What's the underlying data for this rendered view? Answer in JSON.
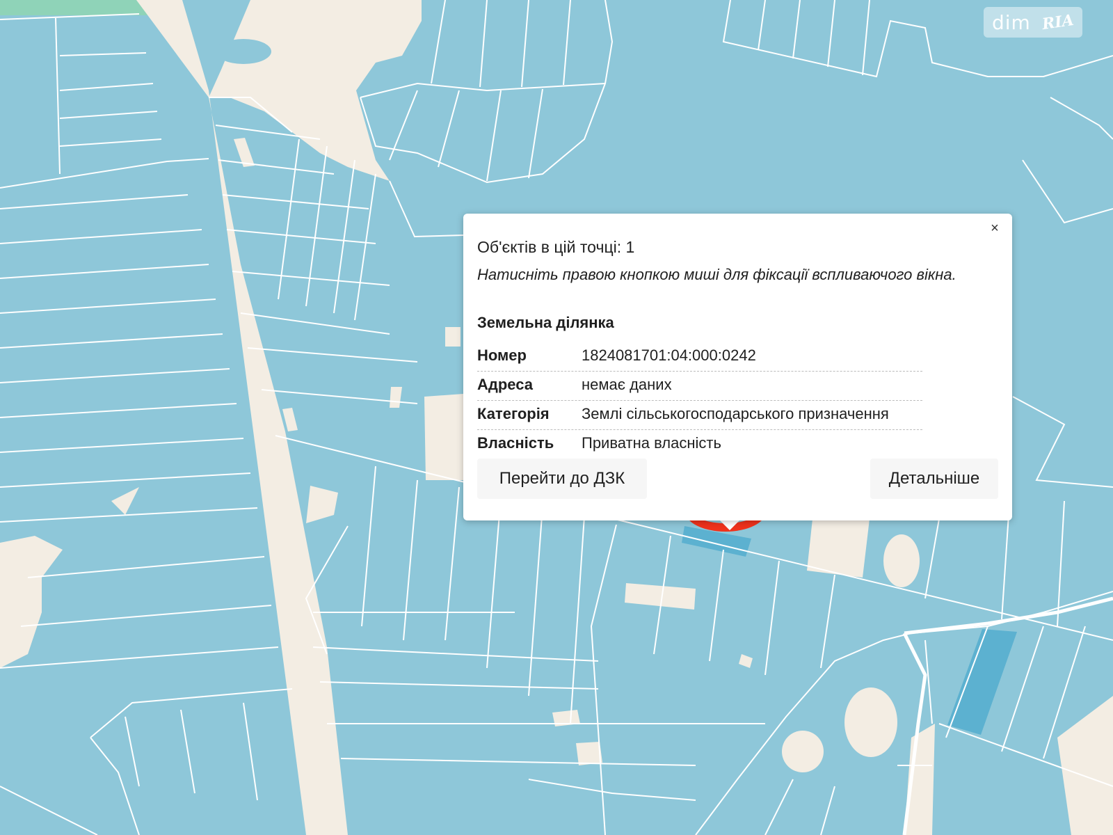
{
  "map": {
    "colors": {
      "parcel": "#8ec7d9",
      "parcel_highlight": "#5cb1d0",
      "road": "#f3ede3",
      "parcel_border": "#ffffff",
      "green_area": "#8fd3b8",
      "marker": "#f0321c"
    }
  },
  "watermark": {
    "brand_left": "dim",
    "brand_right": "RIA"
  },
  "popup": {
    "close_label": "×",
    "count_text": "Об'єктів в цій точці: 1",
    "hint_text": "Натисніть правою кнопкою миші для фіксації вспливаючого вікна.",
    "section_title": "Земельна ділянка",
    "rows": [
      {
        "key": "Номер",
        "value": "1824081701:04:000:0242"
      },
      {
        "key": "Адреса",
        "value": "немає даних"
      },
      {
        "key": "Категорія",
        "value": "Землі сільськогосподарського призначення"
      },
      {
        "key": "Власність",
        "value": "Приватна власність"
      }
    ],
    "button_dzk": "Перейти до ДЗК",
    "button_more": "Детальніше"
  }
}
